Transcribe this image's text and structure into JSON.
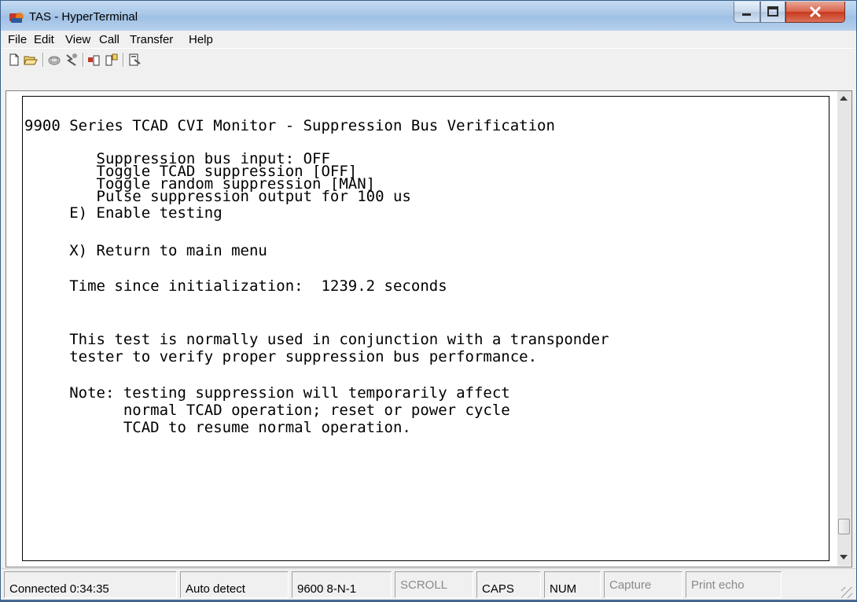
{
  "window": {
    "title": "TAS - HyperTerminal"
  },
  "menu": [
    "File",
    "Edit",
    "View",
    "Call",
    "Transfer",
    "Help"
  ],
  "toolbar_icons": [
    "new-document-icon",
    "open-folder-icon",
    "call-phone-icon",
    "disconnect-icon",
    "send-file-icon",
    "receive-file-icon",
    "properties-icon"
  ],
  "terminal": {
    "lines": [
      "9900 Series TCAD CVI Monitor - Suppression Bus Verification",
      "        Suppression bus input: OFF",
      "        Toggle TCAD suppression [OFF]",
      "        Toggle random suppression [MAN]",
      "        Pulse suppression output for 100 us",
      "     E) Enable testing",
      "     X) Return to main menu",
      "     Time since initialization:  1239.2 seconds",
      "     This test is normally used in conjunction with a transponder",
      "     tester to verify proper suppression bus performance.",
      "     Note: testing suppression will temporarily affect",
      "           normal TCAD operation; reset or power cycle",
      "           TCAD to resume normal operation."
    ]
  },
  "status": {
    "connected": "Connected 0:34:35",
    "detect": "Auto detect",
    "settings": "9600 8-N-1",
    "scroll": "SCROLL",
    "caps": "CAPS",
    "num": "NUM",
    "capture": "Capture",
    "print_echo": "Print echo"
  }
}
